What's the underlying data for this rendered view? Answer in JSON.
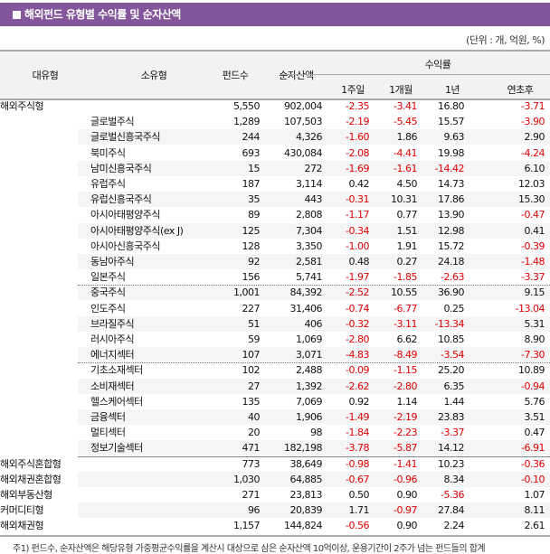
{
  "title": "해외펀드 유형별 수익률 및 순자산액",
  "unit": "(단위 : 개, 억원, %)",
  "headers": {
    "major": "대유형",
    "minor": "소유형",
    "count": "펀드수",
    "assets": "순자산액",
    "returns": "수익률",
    "w1": "1주일",
    "m1": "1개월",
    "y1": "1년",
    "ytd": "연초후"
  },
  "rows": [
    {
      "major": "해외주식형",
      "minor": "",
      "count": "5,550",
      "assets": "902,004",
      "w1": "-2.35",
      "m1": "-3.41",
      "y1": "16.80",
      "ytd": "-3.71"
    },
    {
      "major": "",
      "minor": "글로벌주식",
      "count": "1,289",
      "assets": "107,503",
      "w1": "-2.19",
      "m1": "-5.45",
      "y1": "15.57",
      "ytd": "-3.90"
    },
    {
      "major": "",
      "minor": "글로벌신흥국주식",
      "count": "244",
      "assets": "4,326",
      "w1": "-1.60",
      "m1": "1.86",
      "y1": "9.63",
      "ytd": "2.90"
    },
    {
      "major": "",
      "minor": "북미주식",
      "count": "693",
      "assets": "430,084",
      "w1": "-2.08",
      "m1": "-4.41",
      "y1": "19.98",
      "ytd": "-4.24"
    },
    {
      "major": "",
      "minor": "남미신흥국주식",
      "count": "15",
      "assets": "272",
      "w1": "-1.69",
      "m1": "-1.61",
      "y1": "-14.42",
      "ytd": "6.10"
    },
    {
      "major": "",
      "minor": "유럽주식",
      "count": "187",
      "assets": "3,114",
      "w1": "0.42",
      "m1": "4.50",
      "y1": "14.73",
      "ytd": "12.03"
    },
    {
      "major": "",
      "minor": "유럽신흥국주식",
      "count": "35",
      "assets": "443",
      "w1": "-0.31",
      "m1": "10.31",
      "y1": "17.86",
      "ytd": "15.30"
    },
    {
      "major": "",
      "minor": "아시아태평양주식",
      "count": "89",
      "assets": "2,808",
      "w1": "-1.17",
      "m1": "0.77",
      "y1": "13.90",
      "ytd": "-0.47"
    },
    {
      "major": "",
      "minor": "아시아태평양주식(ex J)",
      "count": "125",
      "assets": "7,304",
      "w1": "-0.34",
      "m1": "1.51",
      "y1": "12.98",
      "ytd": "0.41"
    },
    {
      "major": "",
      "minor": "아시아신흥국주식",
      "count": "128",
      "assets": "3,350",
      "w1": "-1.00",
      "m1": "1.91",
      "y1": "15.72",
      "ytd": "-0.39"
    },
    {
      "major": "",
      "minor": "동남아주식",
      "count": "92",
      "assets": "2,581",
      "w1": "0.48",
      "m1": "0.27",
      "y1": "24.18",
      "ytd": "-1.48"
    },
    {
      "major": "",
      "minor": "일본주식",
      "count": "156",
      "assets": "5,741",
      "w1": "-1.97",
      "m1": "-1.85",
      "y1": "-2.63",
      "ytd": "-3.37"
    },
    {
      "major": "",
      "minor": "중국주식",
      "count": "1,001",
      "assets": "84,392",
      "w1": "-2.52",
      "m1": "10.55",
      "y1": "36.90",
      "ytd": "9.15"
    },
    {
      "major": "",
      "minor": "인도주식",
      "count": "227",
      "assets": "31,406",
      "w1": "-0.74",
      "m1": "-6.77",
      "y1": "0.25",
      "ytd": "-13.04"
    },
    {
      "major": "",
      "minor": "브라질주식",
      "count": "51",
      "assets": "406",
      "w1": "-0.32",
      "m1": "-3.11",
      "y1": "-13.34",
      "ytd": "5.31"
    },
    {
      "major": "",
      "minor": "러시아주식",
      "count": "59",
      "assets": "1,069",
      "w1": "-2.80",
      "m1": "6.62",
      "y1": "10.85",
      "ytd": "8.90"
    },
    {
      "major": "",
      "minor": "에너지섹터",
      "count": "107",
      "assets": "3,071",
      "w1": "-4.83",
      "m1": "-8.49",
      "y1": "-3.54",
      "ytd": "-7.30"
    },
    {
      "major": "",
      "minor": "기초소재섹터",
      "count": "102",
      "assets": "2,488",
      "w1": "-0.09",
      "m1": "-1.15",
      "y1": "25.20",
      "ytd": "10.89"
    },
    {
      "major": "",
      "minor": "소비재섹터",
      "count": "27",
      "assets": "1,392",
      "w1": "-2.62",
      "m1": "-2.80",
      "y1": "6.35",
      "ytd": "-0.94"
    },
    {
      "major": "",
      "minor": "헬스케어섹터",
      "count": "135",
      "assets": "7,069",
      "w1": "0.92",
      "m1": "1.14",
      "y1": "1.44",
      "ytd": "5.76"
    },
    {
      "major": "",
      "minor": "금융섹터",
      "count": "40",
      "assets": "1,906",
      "w1": "-1.49",
      "m1": "-2.19",
      "y1": "23.83",
      "ytd": "3.51"
    },
    {
      "major": "",
      "minor": "멀티섹터",
      "count": "20",
      "assets": "98",
      "w1": "-1.84",
      "m1": "-2.23",
      "y1": "-3.37",
      "ytd": "0.47"
    },
    {
      "major": "",
      "minor": "정보기술섹터",
      "count": "471",
      "assets": "182,198",
      "w1": "-3.78",
      "m1": "-5.87",
      "y1": "14.12",
      "ytd": "-6.91"
    },
    {
      "major": "해외주식혼합형",
      "minor": "",
      "count": "773",
      "assets": "38,649",
      "w1": "-0.98",
      "m1": "-1.41",
      "y1": "10.23",
      "ytd": "-0.36"
    },
    {
      "major": "해외채권혼합형",
      "minor": "",
      "count": "1,030",
      "assets": "64,885",
      "w1": "-0.67",
      "m1": "-0.96",
      "y1": "8.34",
      "ytd": "-0.10"
    },
    {
      "major": "해외부동산형",
      "minor": "",
      "count": "271",
      "assets": "23,813",
      "w1": "0.50",
      "m1": "0.90",
      "y1": "-5.36",
      "ytd": "1.07"
    },
    {
      "major": "커머디티형",
      "minor": "",
      "count": "96",
      "assets": "20,839",
      "w1": "1.71",
      "m1": "-0.97",
      "y1": "27.84",
      "ytd": "8.11"
    },
    {
      "major": "해외채권형",
      "minor": "",
      "count": "1,157",
      "assets": "144,824",
      "w1": "-0.56",
      "m1": "0.90",
      "y1": "2.24",
      "ytd": "2.61"
    }
  ],
  "note": "주1) 펀드수, 순자산액은 해당유형 가중평균수익률을 계산시 대상으로 삼은 순자산액 10억이상, 운용기간이 2주가 넘는 펀드들의 합계",
  "colors": {
    "title_bar": "#83559a",
    "negative": "#e00000"
  }
}
